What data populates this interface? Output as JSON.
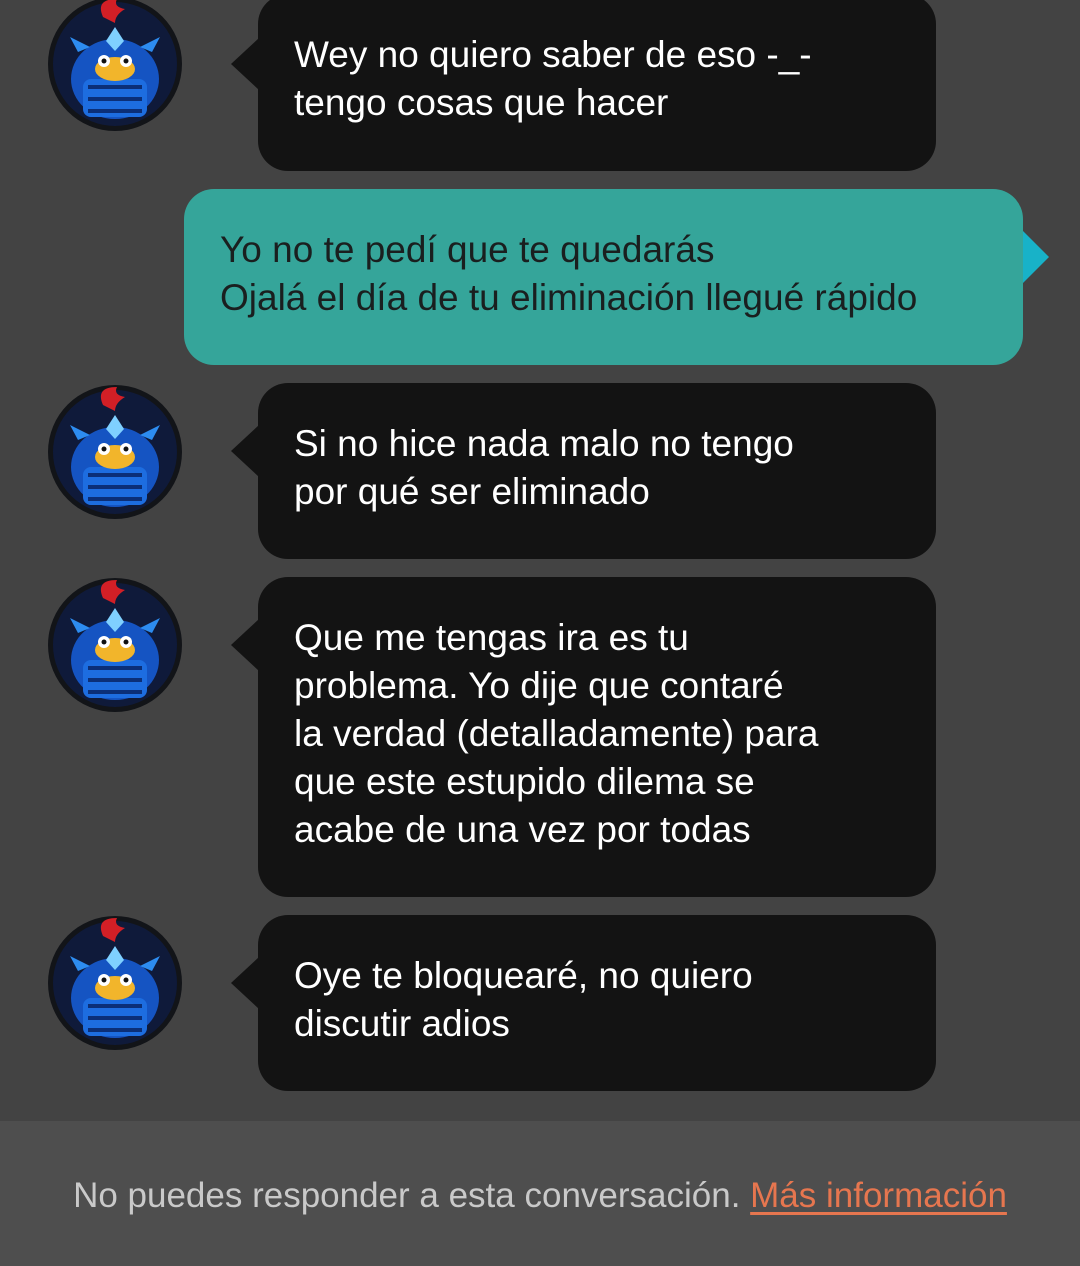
{
  "messages": [
    {
      "sender": "other",
      "text": "Wey no quiero saber de eso -_-\ntengo cosas que hacer"
    },
    {
      "sender": "me",
      "text": "Yo no te pedí que te quedarás\nOjalá el día de tu eliminación llegué rápido"
    },
    {
      "sender": "other",
      "text": "Si no hice nada malo no tengo\npor qué ser eliminado"
    },
    {
      "sender": "other",
      "text": "Que me tengas ira es tu\nproblema. Yo dije que contaré\nla verdad (detalladamente) para\nque este estupido dilema se\nacabe de una vez por todas"
    },
    {
      "sender": "other",
      "text": "Oye te bloquearé, no quiero\ndiscutir adios"
    }
  ],
  "footer": {
    "notice": "No puedes responder a esta conversación.",
    "link": "Más información"
  },
  "colors": {
    "background": "#434343",
    "incoming_bubble": "#131313",
    "outgoing_bubble": "#35a59a",
    "link": "#e6764f"
  },
  "icons": {
    "avatar": "blue-armored-bird-avatar-icon"
  }
}
